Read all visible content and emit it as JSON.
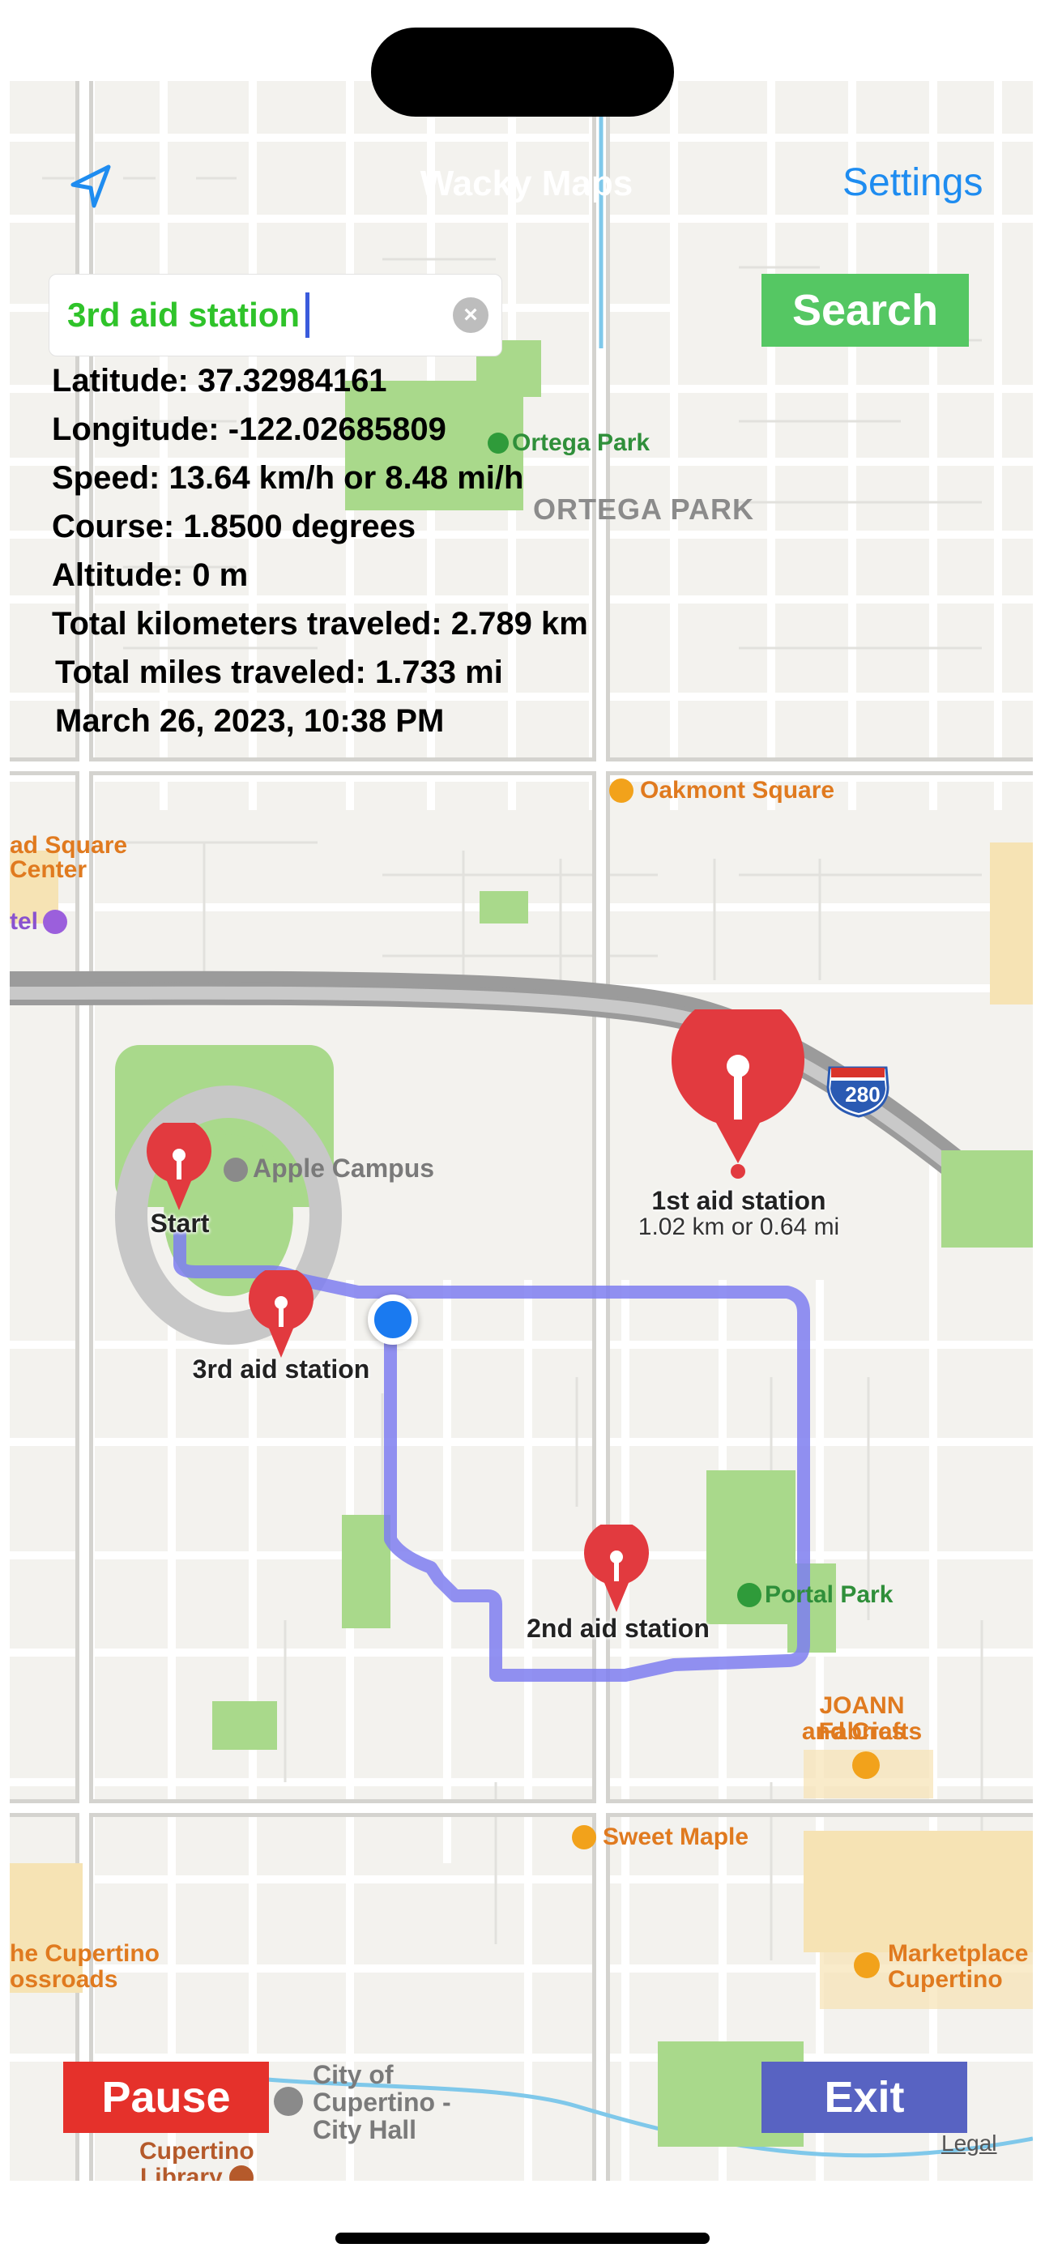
{
  "app": {
    "title": "Wacky Maps",
    "settings_label": "Settings"
  },
  "search": {
    "value": "3rd aid station",
    "clear_icon": "clear-circle-icon",
    "button_label": "Search"
  },
  "info": {
    "latitude": "Latitude: 37.32984161",
    "longitude": "Longitude: -122.02685809",
    "speed": "Speed: 13.64 km/h or 8.48 mi/h",
    "course": "Course: 1.8500 degrees",
    "altitude": "Altitude: 0 m",
    "total_km": "Total kilometers traveled: 2.789 km",
    "total_mi": "Total miles traveled: 1.733 mi",
    "datetime": "March 26, 2023, 10:38 PM"
  },
  "map": {
    "places": {
      "ortega_park": "Ortega Park",
      "ortega_park_caps": "ORTEGA PARK",
      "oakmont_square": "Oakmont Square",
      "bend_square_1": "ad Square",
      "bend_square_2": "Center",
      "hotel": "tel",
      "apple_campus": "Apple Campus",
      "portal_park": "Portal Park",
      "joann_1": "JOANN Fabrics",
      "joann_2": "and Crafts",
      "sweet_maple": "Sweet Maple",
      "cupertino_crossroads_1": "he Cupertino",
      "cupertino_crossroads_2": "ossroads",
      "marketplace_1": "Marketplace",
      "marketplace_2": "Cupertino",
      "city_hall_1": "City of",
      "city_hall_2": "Cupertino -",
      "city_hall_3": "City Hall",
      "library_1": "Cupertino",
      "library_2": "Library",
      "highway": "280"
    },
    "pins": {
      "start": "Start",
      "first": "1st aid station",
      "first_distance": "1.02 km or 0.64 mi",
      "second": "2nd aid station",
      "third": "3rd aid station"
    },
    "legal": "Legal"
  },
  "controls": {
    "pause_label": "Pause",
    "exit_label": "Exit"
  },
  "colors": {
    "route": "#7e7ef0",
    "pin": "#e23a3f",
    "search_green": "#55c763",
    "pause_red": "#e5312b",
    "exit_blue": "#5863c2",
    "settings_blue": "#1e8cf0"
  }
}
